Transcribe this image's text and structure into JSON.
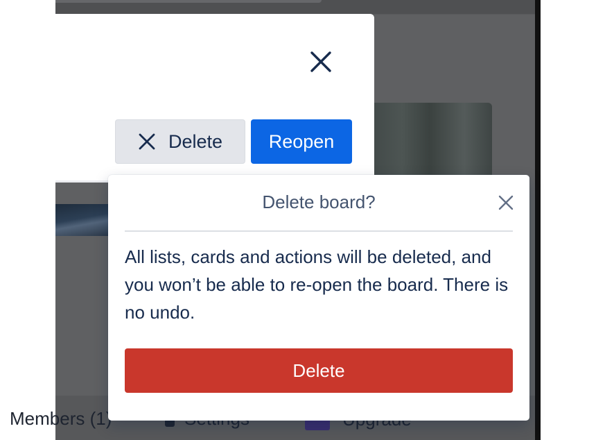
{
  "board_panel": {
    "delete_label": "Delete",
    "reopen_label": "Reopen"
  },
  "popover": {
    "title": "Delete board?",
    "message": "All lists, cards and actions will be deleted, and you won’t be able to re-open the board. There is no undo.",
    "delete_label": "Delete"
  },
  "background_footer": {
    "members_label": "Members (1)",
    "settings_label": "Settings",
    "upgrade_label": "Upgrade"
  },
  "colors": {
    "reopen_button": "#0c66e4",
    "danger_button": "#c9372c",
    "secondary_button": "#e3e5ea"
  },
  "icons": [
    "close-icon",
    "x-icon",
    "pin-icon",
    "upgrade-icon"
  ]
}
